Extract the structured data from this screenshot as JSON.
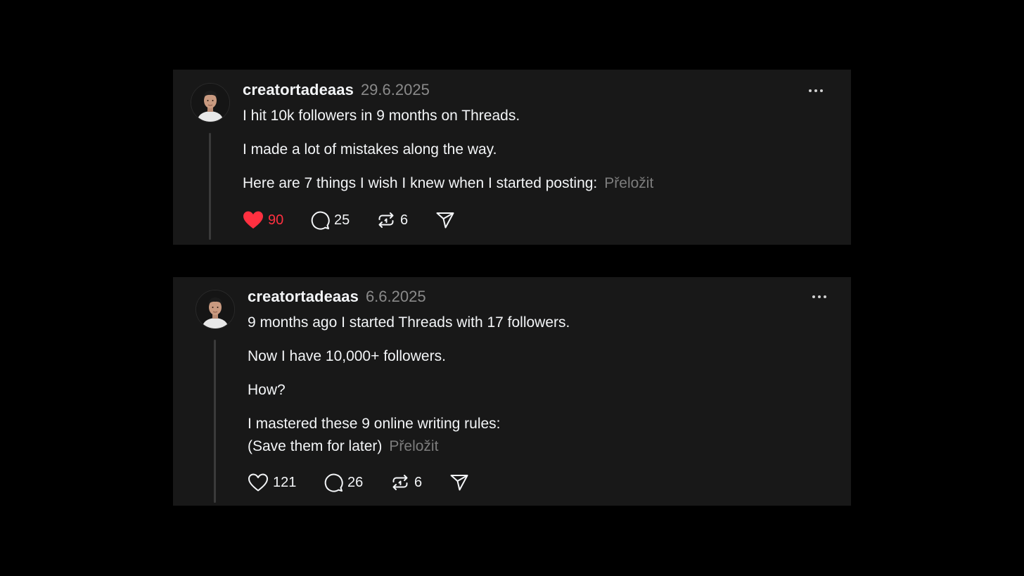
{
  "colors": {
    "background": "#000000",
    "card": "#181818",
    "text": "#f3f5f7",
    "muted": "#8a8a8a",
    "like_active": "#ff3040"
  },
  "posts": [
    {
      "username": "creatortadeaas",
      "date": "29.6.2025",
      "paragraphs": [
        "I hit 10k followers in 9 months on Threads.",
        "I made a lot of mistakes along the way.",
        "Here are 7 things I wish I knew when I started posting:"
      ],
      "translate_label": "Přeložit",
      "liked": true,
      "likes": "90",
      "replies": "25",
      "reposts": "6",
      "icons": [
        "heart-filled-icon",
        "comment-icon",
        "repost-icon",
        "share-icon",
        "more-icon"
      ]
    },
    {
      "username": "creatortadeaas",
      "date": "6.6.2025",
      "paragraphs": [
        "9 months ago I started Threads with 17 followers.",
        "Now I have 10,000+ followers.",
        "How?",
        "I mastered these 9 online writing rules:",
        "(Save them for later)"
      ],
      "translate_label": "Přeložit",
      "liked": false,
      "likes": "121",
      "replies": "26",
      "reposts": "6",
      "icons": [
        "heart-outline-icon",
        "comment-icon",
        "repost-icon",
        "share-icon",
        "more-icon"
      ]
    }
  ]
}
